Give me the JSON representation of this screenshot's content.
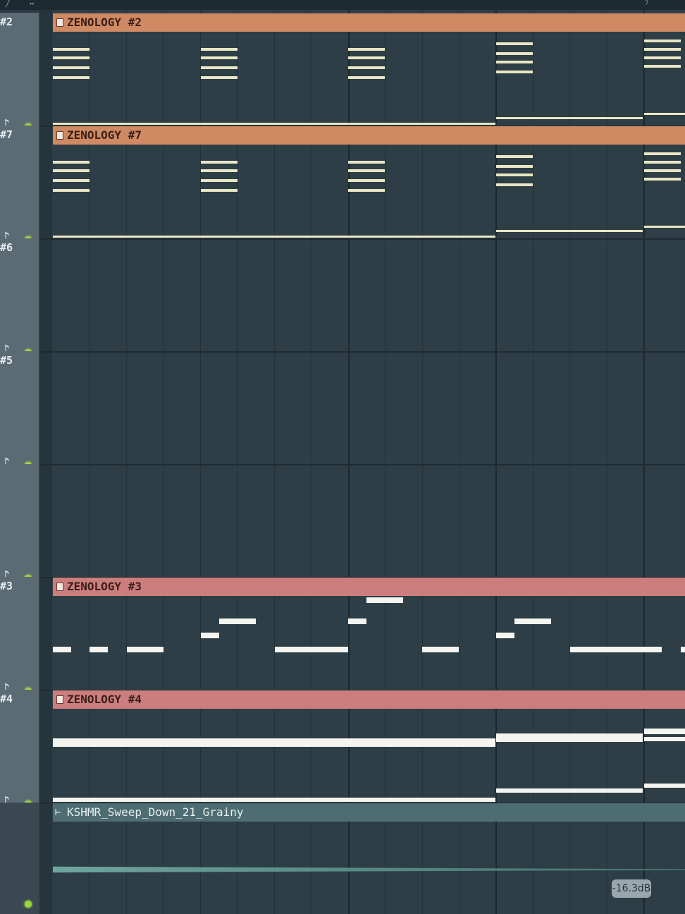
{
  "toolbar": {
    "pencil_icon": "pencil-icon",
    "resize_icon": "resize-icon",
    "marker_label": "7"
  },
  "tracks": [
    {
      "label": "#2",
      "clip": "ZENOLOGY #2",
      "clip_color": "#cf8a63"
    },
    {
      "label": "#7",
      "clip": "ZENOLOGY #7",
      "clip_color": "#cf8a63"
    },
    {
      "label": "#6",
      "clip": ""
    },
    {
      "label": "#5",
      "clip": ""
    },
    {
      "label": "",
      "clip": ""
    },
    {
      "label": "#3",
      "clip": "ZENOLOGY #3",
      "clip_color": "#cc7e7e"
    },
    {
      "label": "#4",
      "clip": "ZENOLOGY #4",
      "clip_color": "#cc7e7e"
    },
    {
      "label": "",
      "clip": "KSHMR_Sweep_Down_21_Grainy",
      "clip_color": "#4e6d72"
    }
  ],
  "audio_clip": {
    "level": "-16.3dB"
  },
  "colors": {
    "led": "#9cd63a",
    "grid_bg": "#2e3e46",
    "note_pale": "#e8e6c4",
    "note_white": "#f4f4f0"
  }
}
